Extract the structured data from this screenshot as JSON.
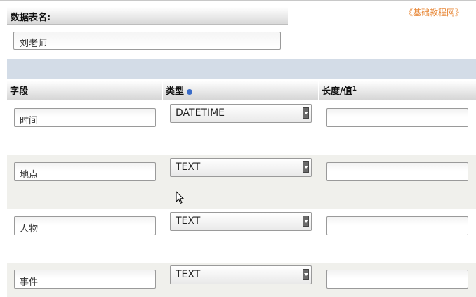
{
  "watermark": "《基础教程网》",
  "table_name": {
    "label": "数据表名:",
    "value": "刘老师"
  },
  "columns": {
    "field": "字段",
    "type": "类型",
    "length_value": "长度/值",
    "length_value_footnote": "1"
  },
  "rows": [
    {
      "field": "时间",
      "type": "DATETIME",
      "length": ""
    },
    {
      "field": "地点",
      "type": "TEXT",
      "length": ""
    },
    {
      "field": "人物",
      "type": "TEXT",
      "length": ""
    },
    {
      "field": "事件",
      "type": "TEXT",
      "length": ""
    }
  ],
  "colors": {
    "band": "#d3dce7",
    "alt_row": "#f0f0ec",
    "watermark": "#e8893a"
  },
  "icons": {
    "type_help": "help-icon",
    "select_arrow": "chevron-down-icon",
    "cursor": "mouse-pointer-icon"
  }
}
